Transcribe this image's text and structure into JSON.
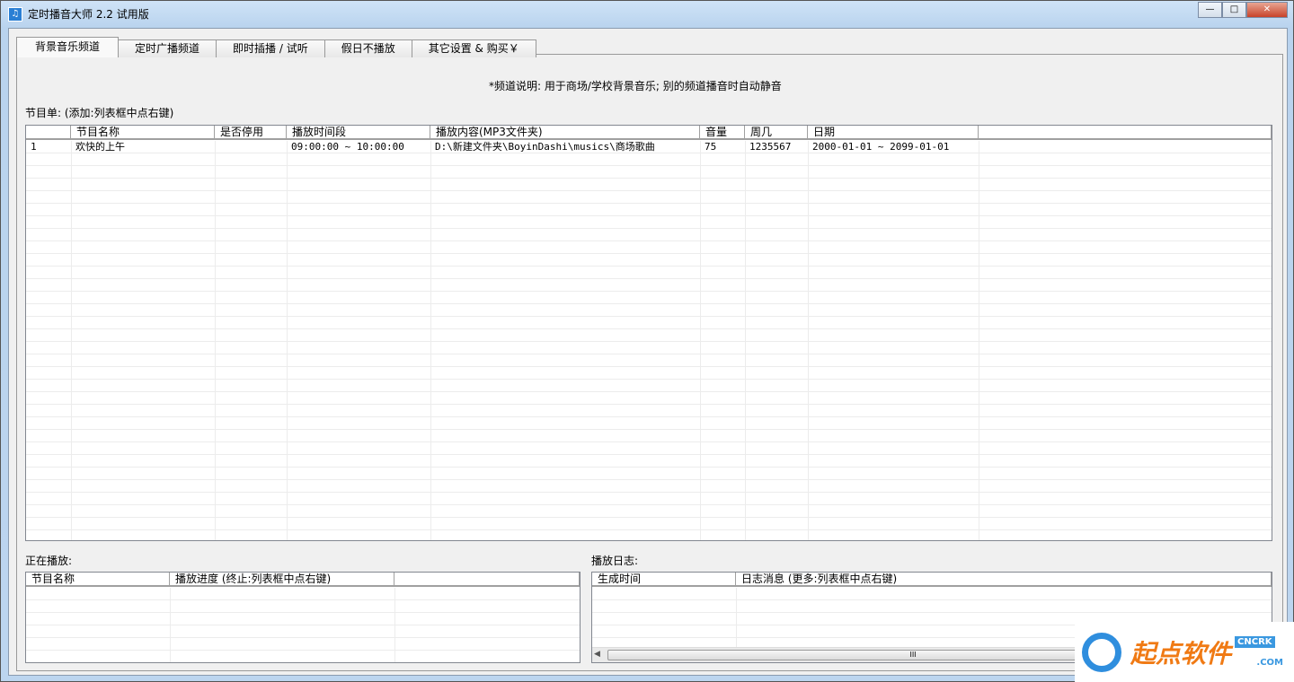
{
  "window": {
    "title": "定时播音大师 2.2 试用版",
    "icon": "app-icon",
    "min": "—",
    "max": "□",
    "close": "✕"
  },
  "tabs": [
    {
      "label": "背景音乐频道"
    },
    {
      "label": "定时广播频道"
    },
    {
      "label": "即时插播 / 试听"
    },
    {
      "label": "假日不播放"
    },
    {
      "label": "其它设置 & 购买￥"
    }
  ],
  "description": "*频道说明:  用于商场/学校背景音乐; 别的频道播音时自动静音",
  "program_label": "节目单: (添加:列表框中点右键)",
  "program_table": {
    "columns": [
      "",
      "节目名称",
      "是否停用",
      "播放时间段",
      "播放内容(MP3文件夹)",
      "音量",
      "周几",
      "日期",
      ""
    ],
    "rows": [
      [
        "1",
        "欢快的上午",
        "",
        "09:00:00 ~ 10:00:00",
        "D:\\新建文件夹\\BoyinDashi\\musics\\商场歌曲",
        "75",
        "1235567",
        "2000-01-01 ~ 2099-01-01",
        ""
      ]
    ]
  },
  "now_playing_label": "正在播放:",
  "now_playing_table": {
    "columns": [
      "节目名称",
      "播放进度 (终止:列表框中点右键)",
      ""
    ]
  },
  "log_label": "播放日志:",
  "log_table": {
    "columns": [
      "生成时间",
      "日志消息 (更多:列表框中点右键)"
    ],
    "scroll_thumb": "III"
  },
  "watermark": {
    "text": "起点软件",
    "badge": "CNCRK",
    "domain": ".COM"
  }
}
